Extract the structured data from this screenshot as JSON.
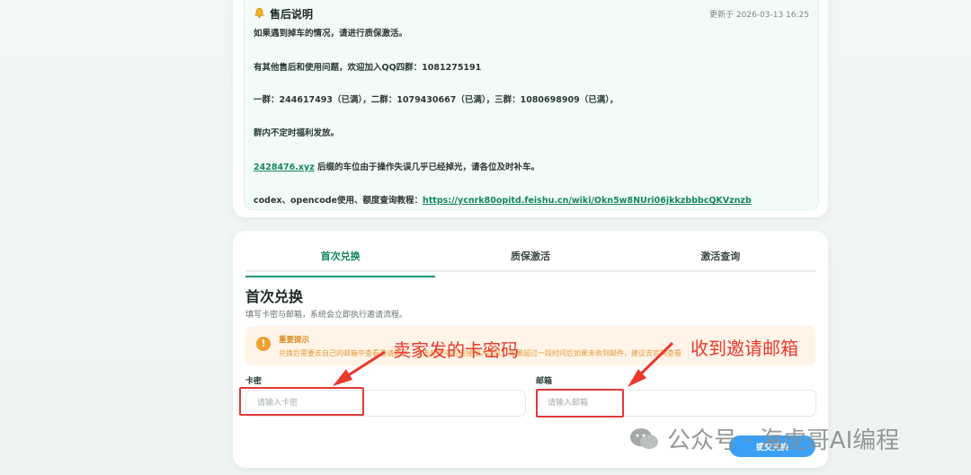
{
  "notice": {
    "title": "售后说明",
    "updated": "更新于 2026-03-13 16:25",
    "line1": "如果遇到掉车的情况，请进行质保激活。",
    "line2": "有其他售后和使用问题，欢迎加入QQ四群：1081275191",
    "line3": "一群：244617493（已满），二群：1079430667（已满），三群：1080698909（已满），",
    "line4": "群内不定时福利发放。",
    "link_domain": "2428476.xyz",
    "line5_rest": " 后缀的车位由于操作失误几乎已经掉光，请各位及时补车。",
    "line6_prefix": "codex、opencode使用、额度查询教程：",
    "line6_link": "https://ycnrk80opitd.feishu.cn/wiki/Okn5w8NUri06jkkzbbbcQKVznzb"
  },
  "tabs": [
    {
      "label": "首次兑换",
      "active": true
    },
    {
      "label": "质保激活",
      "active": false
    },
    {
      "label": "激活查询",
      "active": false
    }
  ],
  "form": {
    "title": "首次兑换",
    "subtitle": "填写卡密与邮箱，系统会立即执行邀请流程。",
    "alert_title": "重要提示",
    "alert_text": "兑换后需要去自己的邮箱中查看邀请邮件，点击邮件中的链接加入团队，如果超过一段时间后如果未收到邮件，建议去官网查看",
    "card_label": "卡密",
    "card_placeholder": "请输入卡密",
    "email_label": "邮箱",
    "email_placeholder": "请输入邮箱",
    "submit_label": "提交兑换"
  },
  "annotations": {
    "card_note": "卖家发的卡密码",
    "email_note": "收到邀请邮箱"
  },
  "watermark": {
    "text": "公众号 · 海虎哥AI编程"
  },
  "colors": {
    "accent": "#17865c",
    "annotation": "#e8392f",
    "warning": "#f0a02e",
    "submit": "#3aa0f5"
  }
}
